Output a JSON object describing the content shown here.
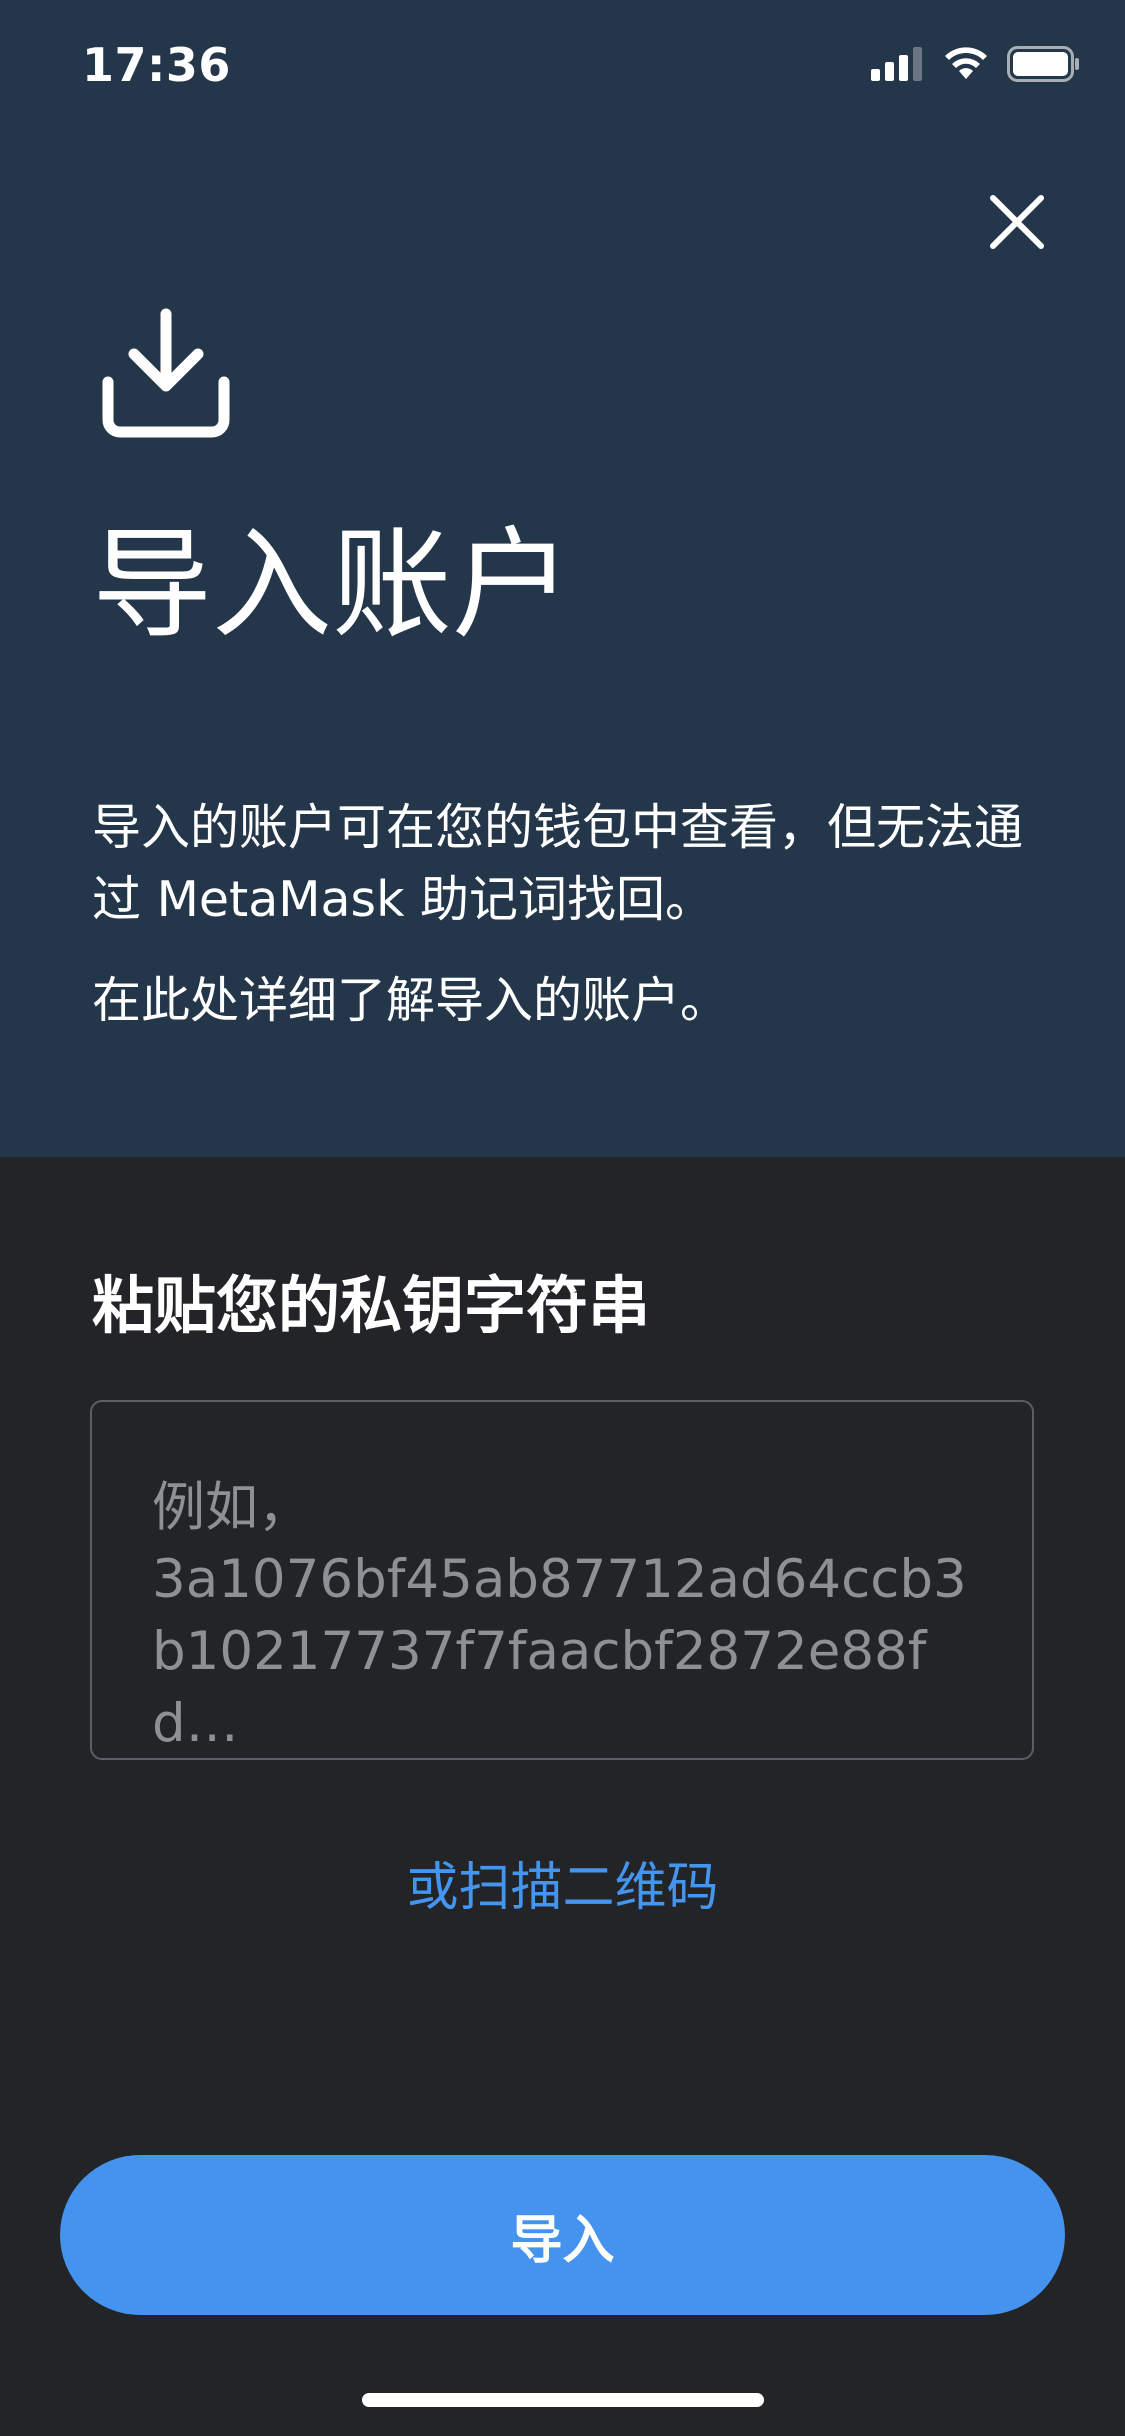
{
  "status_bar": {
    "time": "17:36",
    "icons": [
      "signal-icon",
      "wifi-icon",
      "battery-icon"
    ]
  },
  "header": {
    "close_icon": "close-icon",
    "import_icon": "download-icon",
    "title": "导入账户",
    "description": "导入的账户可在您的钱包中查看，但无法通过 MetaMask 助记词找回。",
    "learn_more": "在此处详细了解导入的账户。"
  },
  "form": {
    "heading": "粘贴您的私钥字符串",
    "placeholder": "例如，\n3a1076bf45ab87712ad64ccb3\nb10217737f7faacbf2872e88fd…",
    "scan_link": "或扫描二维码",
    "import_button": "导入"
  },
  "colors": {
    "header_background": "#24364a",
    "body_background": "#232428",
    "accent": "#4493ee",
    "link": "#4495f0"
  }
}
